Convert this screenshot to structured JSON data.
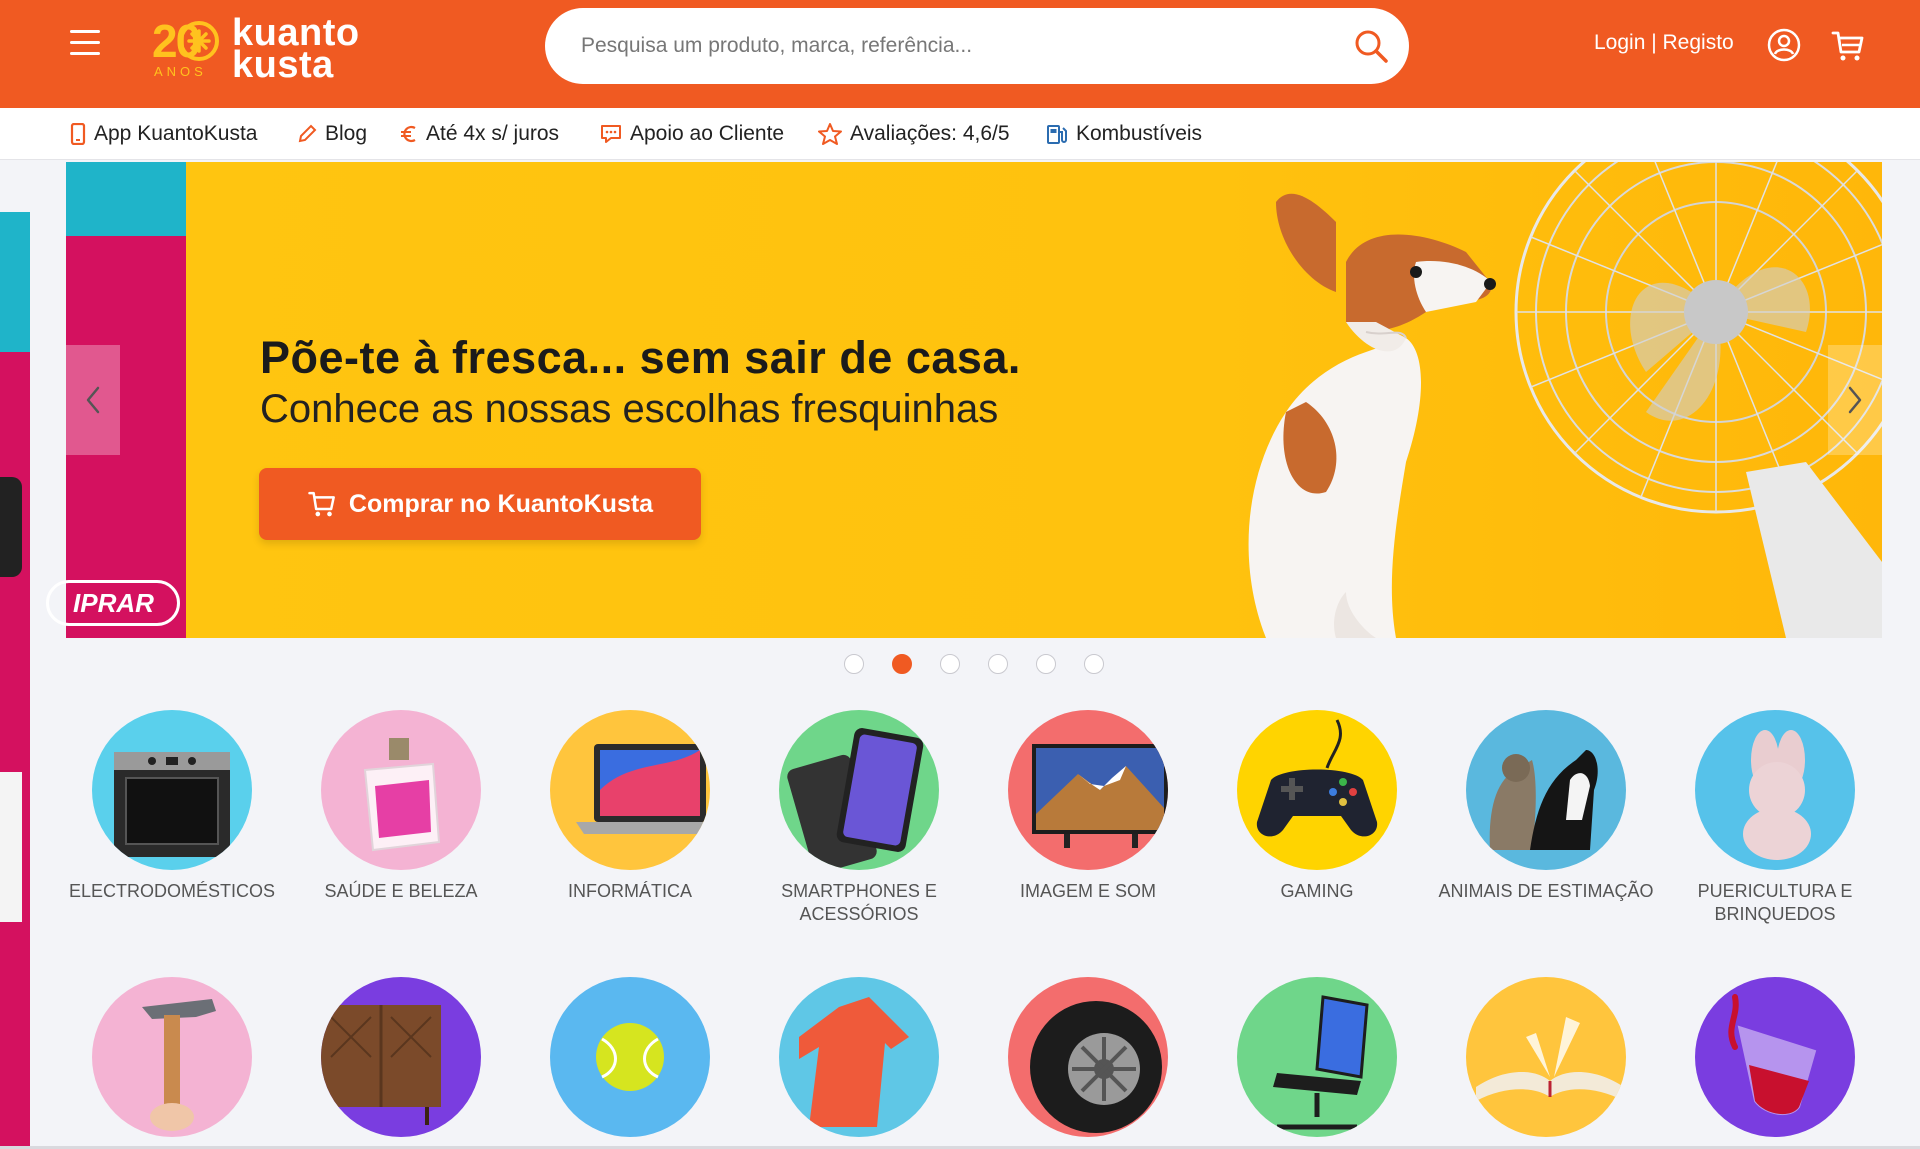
{
  "header": {
    "logo_number": "20",
    "logo_anos": "ANOS",
    "logo_line1": "kuanto",
    "logo_line2": "kusta",
    "search_placeholder": "Pesquisa um produto, marca, referência...",
    "login_label": "Login | Registo",
    "brand_color": "#f05a22"
  },
  "subnav": [
    {
      "label": "App KuantoKusta",
      "icon": "phone-icon"
    },
    {
      "label": "Blog",
      "icon": "pencil-icon"
    },
    {
      "label": "Até 4x s/ juros",
      "icon": "euro-icon"
    },
    {
      "label": "Apoio ao Cliente",
      "icon": "chat-icon"
    },
    {
      "label": "Avaliações: 4,6/5",
      "icon": "star-icon"
    },
    {
      "label": "Kombustíveis",
      "icon": "fuel-icon"
    }
  ],
  "carousel": {
    "prev_slide_button": "IPRAR",
    "headline": "Põe-te à fresca... sem sair de casa.",
    "subheadline": "Conhece as nossas escolhas fresquinhas",
    "cta_label": "Comprar no KuantoKusta",
    "active_dot": 2,
    "dot_count": 6
  },
  "categories_row1": [
    {
      "label": "ELECTRODOMÉSTICOS",
      "color": "#5ad0ec"
    },
    {
      "label": "SAÚDE E BELEZA",
      "color": "#f4b3d3"
    },
    {
      "label": "INFORMÁTICA",
      "color": "#ffc53d"
    },
    {
      "label": "SMARTPHONES E ACESSÓRIOS",
      "color": "#6fd68a"
    },
    {
      "label": "IMAGEM E SOM",
      "color": "#f36d6d"
    },
    {
      "label": "GAMING",
      "color": "#ffd400"
    },
    {
      "label": "ANIMAIS DE ESTIMAÇÃO",
      "color": "#5ab8de"
    },
    {
      "label": "PUERICULTURA E BRINQUEDOS",
      "color": "#56c2ea"
    }
  ],
  "categories_row2": [
    {
      "color": "#f4b3d3"
    },
    {
      "color": "#7a3de0"
    },
    {
      "color": "#5ab8f0"
    },
    {
      "color": "#5fc7e6"
    },
    {
      "color": "#f36d6d"
    },
    {
      "color": "#6fd68a"
    },
    {
      "color": "#ffc53d"
    },
    {
      "color": "#7a3de0"
    }
  ]
}
